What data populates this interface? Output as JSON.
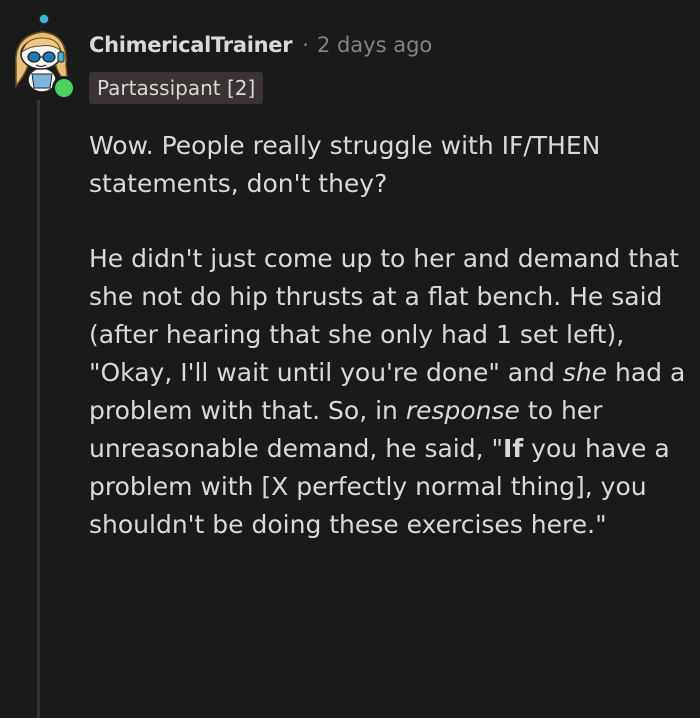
{
  "comment": {
    "author": "ChimericalTrainer",
    "separator": "·",
    "timestamp": "2 days ago",
    "flair": "Partassipant [2]",
    "avatar_icon": "snoo-avatar-icon",
    "online_icon": "online-status-icon",
    "online_color": "#46d160",
    "paragraph1": "Wow. People really struggle with IF/THEN statements, don't they?",
    "paragraph2": {
      "s1": "He didn't just come up to her and demand that she not do hip thrusts at a flat bench. He said (after hearing that she only had 1 set left), \"Okay, I'll wait until you're done\" and ",
      "em1": "she",
      "s2": " had a problem with that. So, in ",
      "em2": "response",
      "s3": " to her unreasonable demand, he said, \"",
      "strong1": "If",
      "s4": " you have a problem with [X perfectly normal thing], you shouldn't be doing these exercises here.\""
    }
  }
}
